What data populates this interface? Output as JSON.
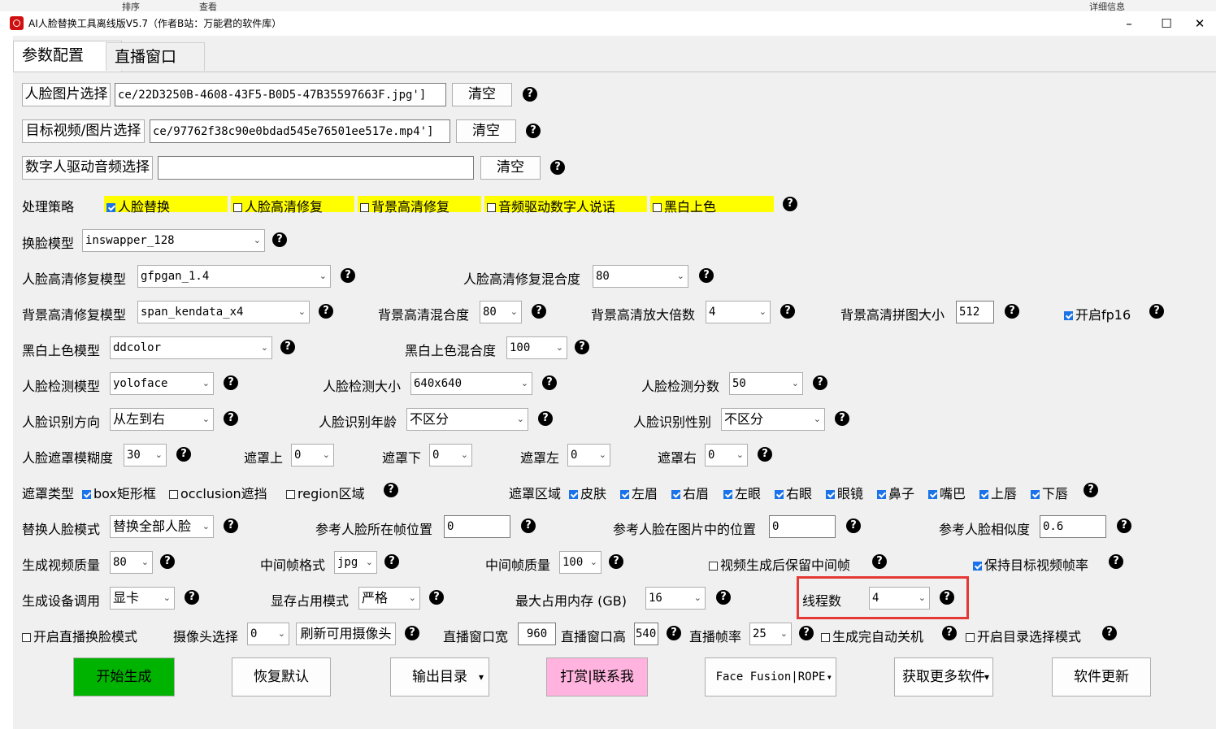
{
  "window": {
    "title": "AI人脸替换工具离线版V5.7（作者B站：万能君的软件库）",
    "minimize": "–",
    "maximize": "☐",
    "close": "✕",
    "bg_fragments": [
      "排序",
      "查看",
      "详细信息"
    ]
  },
  "tabs": [
    {
      "label": "参数配置",
      "active": true
    },
    {
      "label": "直播窗口",
      "active": false
    }
  ],
  "files": {
    "face_image_button": "人脸图片选择",
    "face_image_value": "ce/22D3250B-4608-43F5-B0D5-47B35597663F.jpg']",
    "target_button": "目标视频/图片选择",
    "target_value": "ce/97762f38c90e0bdad545e76501ee517e.mp4']",
    "audio_button": "数字人驱动音频选择",
    "audio_value": "",
    "clear": "清空"
  },
  "help_glyph": "?",
  "strategy": {
    "label": "处理策略",
    "options": [
      {
        "label": "人脸替换",
        "checked": true
      },
      {
        "label": "人脸高清修复",
        "checked": false
      },
      {
        "label": "背景高清修复",
        "checked": false
      },
      {
        "label": "音频驱动数字人说话",
        "checked": false
      },
      {
        "label": "黑白上色",
        "checked": false
      }
    ],
    "highlight_color": "#ffff00"
  },
  "swap_model": {
    "label": "换脸模型",
    "value": "inswapper_128"
  },
  "face_enhance": {
    "model_label": "人脸高清修复模型",
    "model_value": "gfpgan_1.4",
    "blend_label": "人脸高清修复混合度",
    "blend_value": "80"
  },
  "bg_enhance": {
    "model_label": "背景高清修复模型",
    "model_value": "span_kendata_x4",
    "blend_label": "背景高清混合度",
    "blend_value": "80",
    "scale_label": "背景高清放大倍数",
    "scale_value": "4",
    "tile_label": "背景高清拼图大小",
    "tile_value": "512",
    "fp16_label": "开启fp16",
    "fp16_checked": true
  },
  "colorize": {
    "model_label": "黑白上色模型",
    "model_value": "ddcolor",
    "blend_label": "黑白上色混合度",
    "blend_value": "100"
  },
  "detect": {
    "model_label": "人脸检测模型",
    "model_value": "yoloface",
    "size_label": "人脸检测大小",
    "size_value": "640x640",
    "score_label": "人脸检测分数",
    "score_value": "50"
  },
  "recognize": {
    "direction_label": "人脸识别方向",
    "direction_value": "从左到右",
    "age_label": "人脸识别年龄",
    "age_value": "不区分",
    "gender_label": "人脸识别性别",
    "gender_value": "不区分"
  },
  "mask": {
    "blur_label": "人脸遮罩模糊度",
    "blur_value": "30",
    "top_label": "遮罩上",
    "top_value": "0",
    "bottom_label": "遮罩下",
    "bottom_value": "0",
    "left_label": "遮罩左",
    "left_value": "0",
    "right_label": "遮罩右",
    "right_value": "0",
    "type_label": "遮罩类型",
    "types": [
      {
        "label": "box矩形框",
        "checked": true
      },
      {
        "label": "occlusion遮挡",
        "checked": false
      },
      {
        "label": "region区域",
        "checked": false
      }
    ],
    "region_label": "遮罩区域",
    "regions": [
      {
        "label": "皮肤",
        "checked": true
      },
      {
        "label": "左眉",
        "checked": true
      },
      {
        "label": "右眉",
        "checked": true
      },
      {
        "label": "左眼",
        "checked": true
      },
      {
        "label": "右眼",
        "checked": true
      },
      {
        "label": "眼镜",
        "checked": true
      },
      {
        "label": "鼻子",
        "checked": true
      },
      {
        "label": "嘴巴",
        "checked": true
      },
      {
        "label": "上唇",
        "checked": true
      },
      {
        "label": "下唇",
        "checked": true
      }
    ]
  },
  "replace": {
    "mode_label": "替换人脸模式",
    "mode_value": "替换全部人脸",
    "ref_frame_label": "参考人脸所在帧位置",
    "ref_frame_value": "0",
    "ref_pos_label": "参考人脸在图片中的位置",
    "ref_pos_value": "0",
    "similarity_label": "参考人脸相似度",
    "similarity_value": "0.6"
  },
  "output": {
    "quality_label": "生成视频质量",
    "quality_value": "80",
    "frame_format_label": "中间帧格式",
    "frame_format_value": "jpg",
    "frame_quality_label": "中间帧质量",
    "frame_quality_value": "100",
    "keep_frames_label": "视频生成后保留中间帧",
    "keep_frames_checked": false,
    "keep_fps_label": "保持目标视频帧率",
    "keep_fps_checked": true
  },
  "device": {
    "device_label": "生成设备调用",
    "device_value": "显卡",
    "vram_label": "显存占用模式",
    "vram_value": "严格",
    "mem_label": "最大占用内存 (GB)",
    "mem_value": "16",
    "threads_label": "线程数",
    "threads_value": "4"
  },
  "live": {
    "enable_label": "开启直播换脸模式",
    "enable_checked": false,
    "camera_label": "摄像头选择",
    "camera_value": "0",
    "refresh_button": "刷新可用摄像头",
    "width_label": "直播窗口宽",
    "width_value": "960",
    "height_label": "直播窗口高",
    "height_value": "540",
    "fps_label": "直播帧率",
    "fps_value": "25",
    "shutdown_label": "生成完自动关机",
    "shutdown_checked": false,
    "dir_mode_label": "开启目录选择模式",
    "dir_mode_checked": false
  },
  "actions": {
    "start": "开始生成",
    "reset": "恢复默认",
    "output_dir": "输出目录",
    "reward": "打赏|联系我",
    "facefusion": "Face Fusion|ROPE",
    "more": "获取更多软件",
    "update": "软件更新",
    "start_color": "#00b300",
    "reward_color": "#ffb3de"
  },
  "dropdown_arrow": "⌄",
  "menu_arrow": "▾"
}
